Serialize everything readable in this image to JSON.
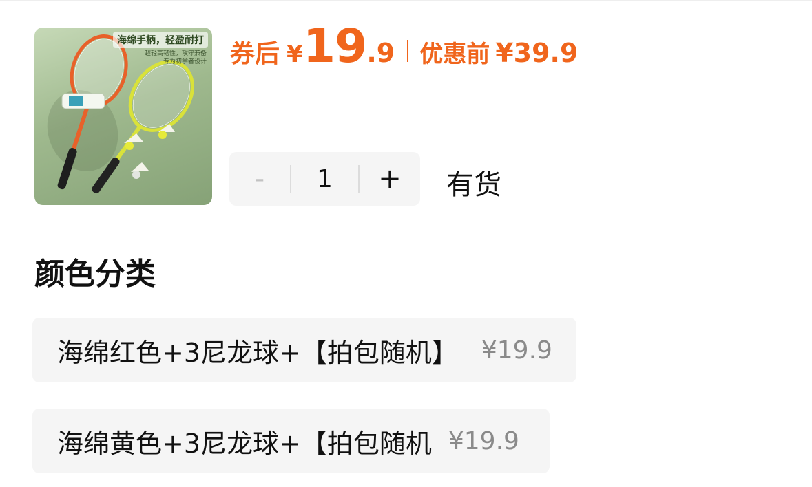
{
  "product": {
    "image_alt": "羽毛球拍套装",
    "image_headline": "海绵手柄，轻盈耐打",
    "image_sub1": "超轻高韧性，攻守兼备",
    "image_sub2": "专为初学者设计"
  },
  "price": {
    "after_coupon_label": "券后",
    "currency": "¥",
    "after_coupon_int": "19",
    "after_coupon_dec": ".9",
    "before_label": "优惠前",
    "before_price": "¥39.9",
    "accent_color": "#f0651c"
  },
  "quantity": {
    "minus": "-",
    "value": "1",
    "plus": "+",
    "stock_status": "有货"
  },
  "color_section": {
    "title": "颜色分类",
    "options": [
      {
        "name": "海绵红色+3尼龙球+【拍包随机】",
        "price": "¥19.9"
      },
      {
        "name": "海绵黄色+3尼龙球+【拍包随机",
        "price": "¥19.9"
      }
    ]
  }
}
